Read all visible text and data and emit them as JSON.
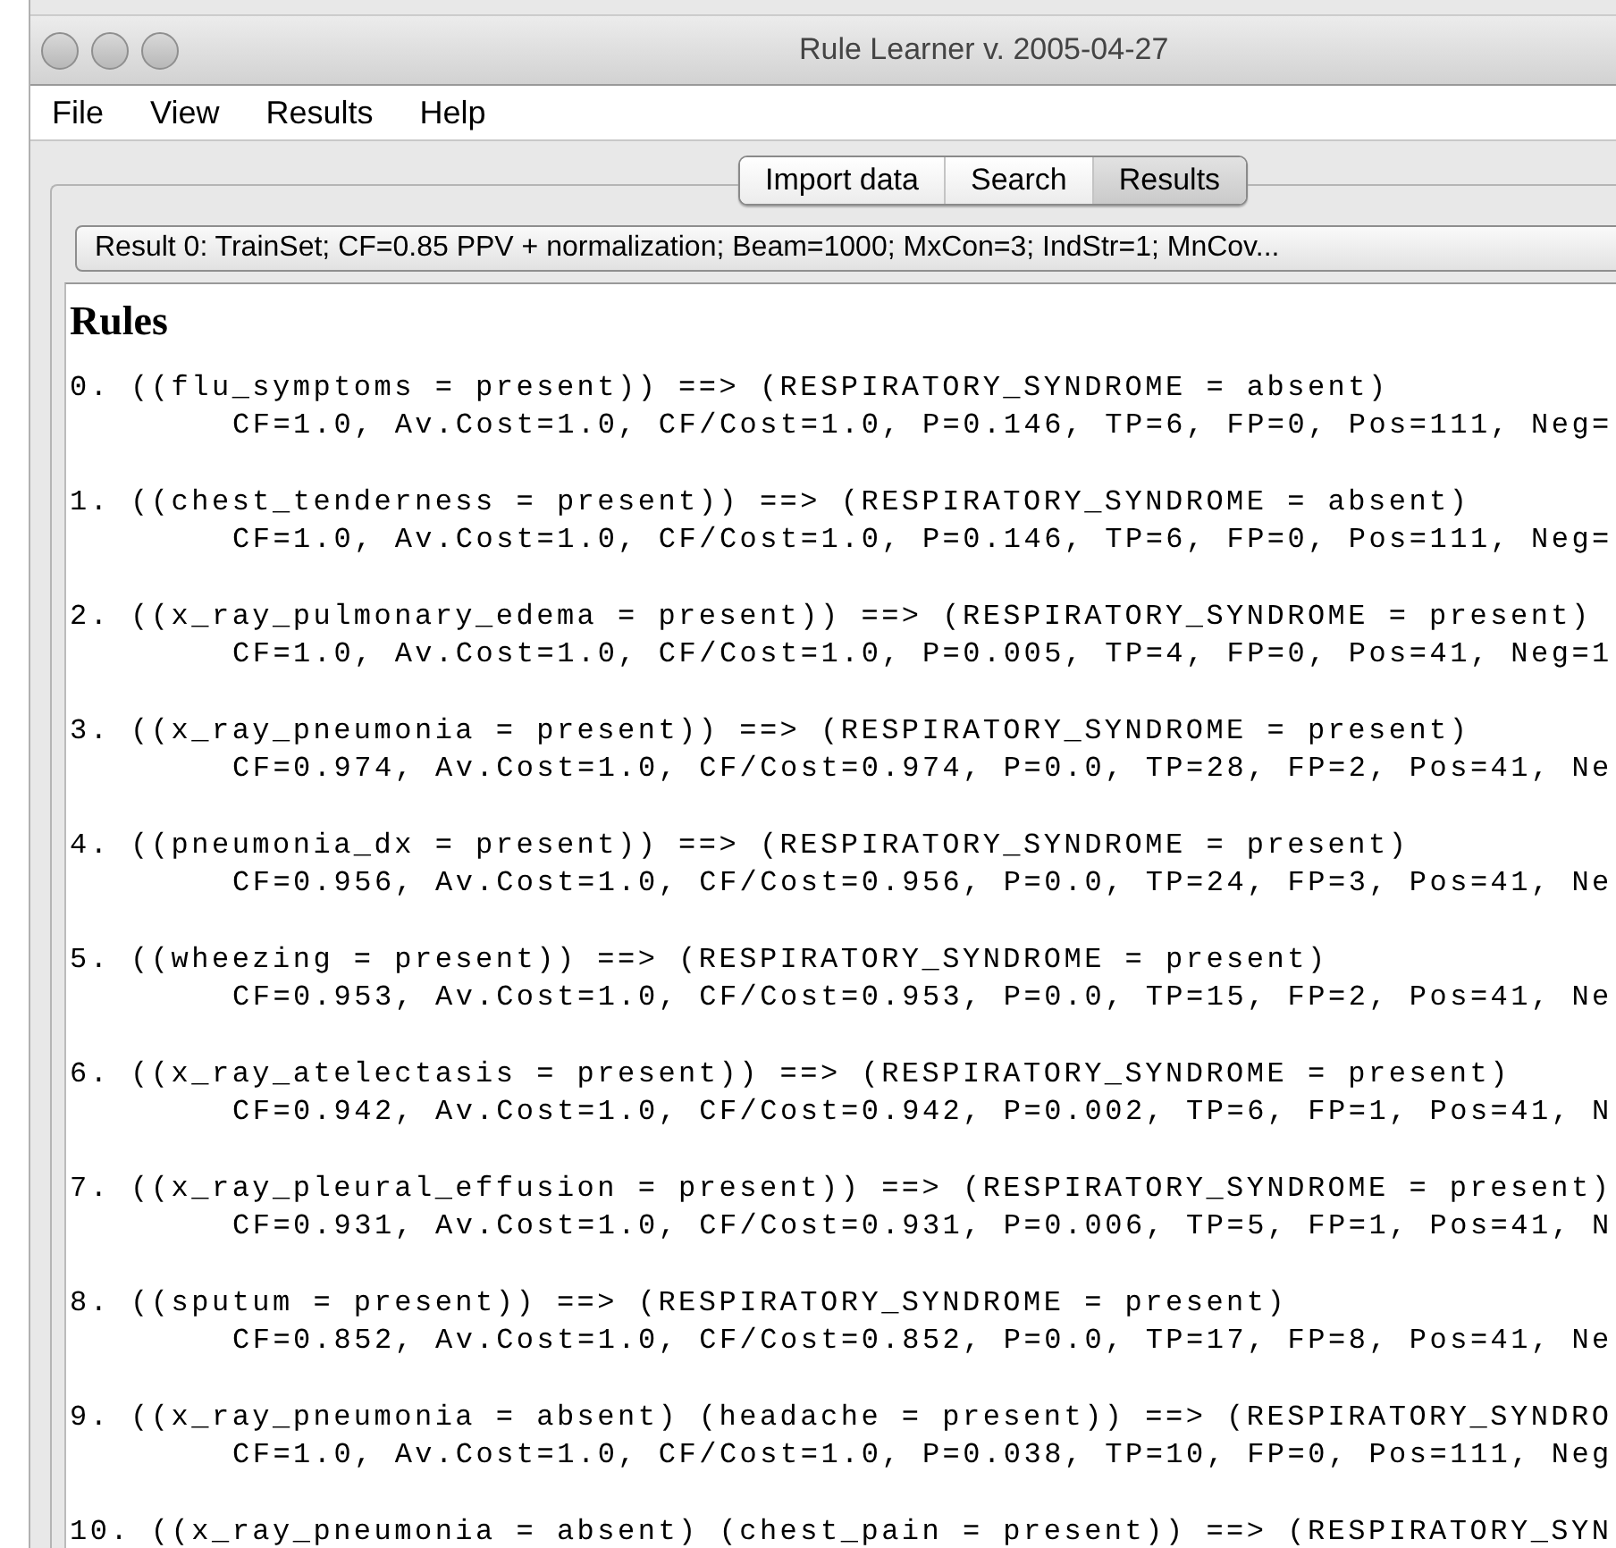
{
  "window": {
    "title": "Rule Learner v. 2005-04-27"
  },
  "menu": [
    "File",
    "View",
    "Results",
    "Help"
  ],
  "tabs": [
    {
      "label": "Import data",
      "selected": false
    },
    {
      "label": "Search",
      "selected": false
    },
    {
      "label": "Results",
      "selected": true
    }
  ],
  "result_selector": {
    "value": "Result 0: TrainSet; CF=0.85 PPV + normalization; Beam=1000; MxCon=3; IndStr=1; MnCov..."
  },
  "rules_heading": "Rules",
  "rules": [
    {
      "rule": "0. ((flu_symptoms = present)) ==> (RESPIRATORY_SYNDROME = absent)",
      "stats": "CF=1.0, Av.Cost=1.0, CF/Cost=1.0, P=0.146, TP=6, FP=0, Pos=111, Neg="
    },
    {
      "rule": "1. ((chest_tenderness = present)) ==> (RESPIRATORY_SYNDROME = absent)",
      "stats": "CF=1.0, Av.Cost=1.0, CF/Cost=1.0, P=0.146, TP=6, FP=0, Pos=111, Neg="
    },
    {
      "rule": "2. ((x_ray_pulmonary_edema = present)) ==> (RESPIRATORY_SYNDROME = present)",
      "stats": "CF=1.0, Av.Cost=1.0, CF/Cost=1.0, P=0.005, TP=4, FP=0, Pos=41, Neg=1"
    },
    {
      "rule": "3. ((x_ray_pneumonia = present)) ==> (RESPIRATORY_SYNDROME = present)",
      "stats": "CF=0.974, Av.Cost=1.0, CF/Cost=0.974, P=0.0, TP=28, FP=2, Pos=41, Ne"
    },
    {
      "rule": "4. ((pneumonia_dx = present)) ==> (RESPIRATORY_SYNDROME = present)",
      "stats": "CF=0.956, Av.Cost=1.0, CF/Cost=0.956, P=0.0, TP=24, FP=3, Pos=41, Ne"
    },
    {
      "rule": "5. ((wheezing = present)) ==> (RESPIRATORY_SYNDROME = present)",
      "stats": "CF=0.953, Av.Cost=1.0, CF/Cost=0.953, P=0.0, TP=15, FP=2, Pos=41, Ne"
    },
    {
      "rule": "6. ((x_ray_atelectasis = present)) ==> (RESPIRATORY_SYNDROME = present)",
      "stats": "CF=0.942, Av.Cost=1.0, CF/Cost=0.942, P=0.002, TP=6, FP=1, Pos=41, N"
    },
    {
      "rule": "7. ((x_ray_pleural_effusion = present)) ==> (RESPIRATORY_SYNDROME = present)",
      "stats": "CF=0.931, Av.Cost=1.0, CF/Cost=0.931, P=0.006, TP=5, FP=1, Pos=41, N"
    },
    {
      "rule": "8. ((sputum = present)) ==> (RESPIRATORY_SYNDROME = present)",
      "stats": "CF=0.852, Av.Cost=1.0, CF/Cost=0.852, P=0.0, TP=17, FP=8, Pos=41, Ne"
    },
    {
      "rule": "9. ((x_ray_pneumonia = absent) (headache = present)) ==> (RESPIRATORY_SYNDRO",
      "stats": "CF=1.0, Av.Cost=1.0, CF/Cost=1.0, P=0.038, TP=10, FP=0, Pos=111, Neg"
    },
    {
      "rule": "10. ((x_ray_pneumonia = absent) (chest_pain = present)) ==> (RESPIRATORY_SYN"
    }
  ]
}
